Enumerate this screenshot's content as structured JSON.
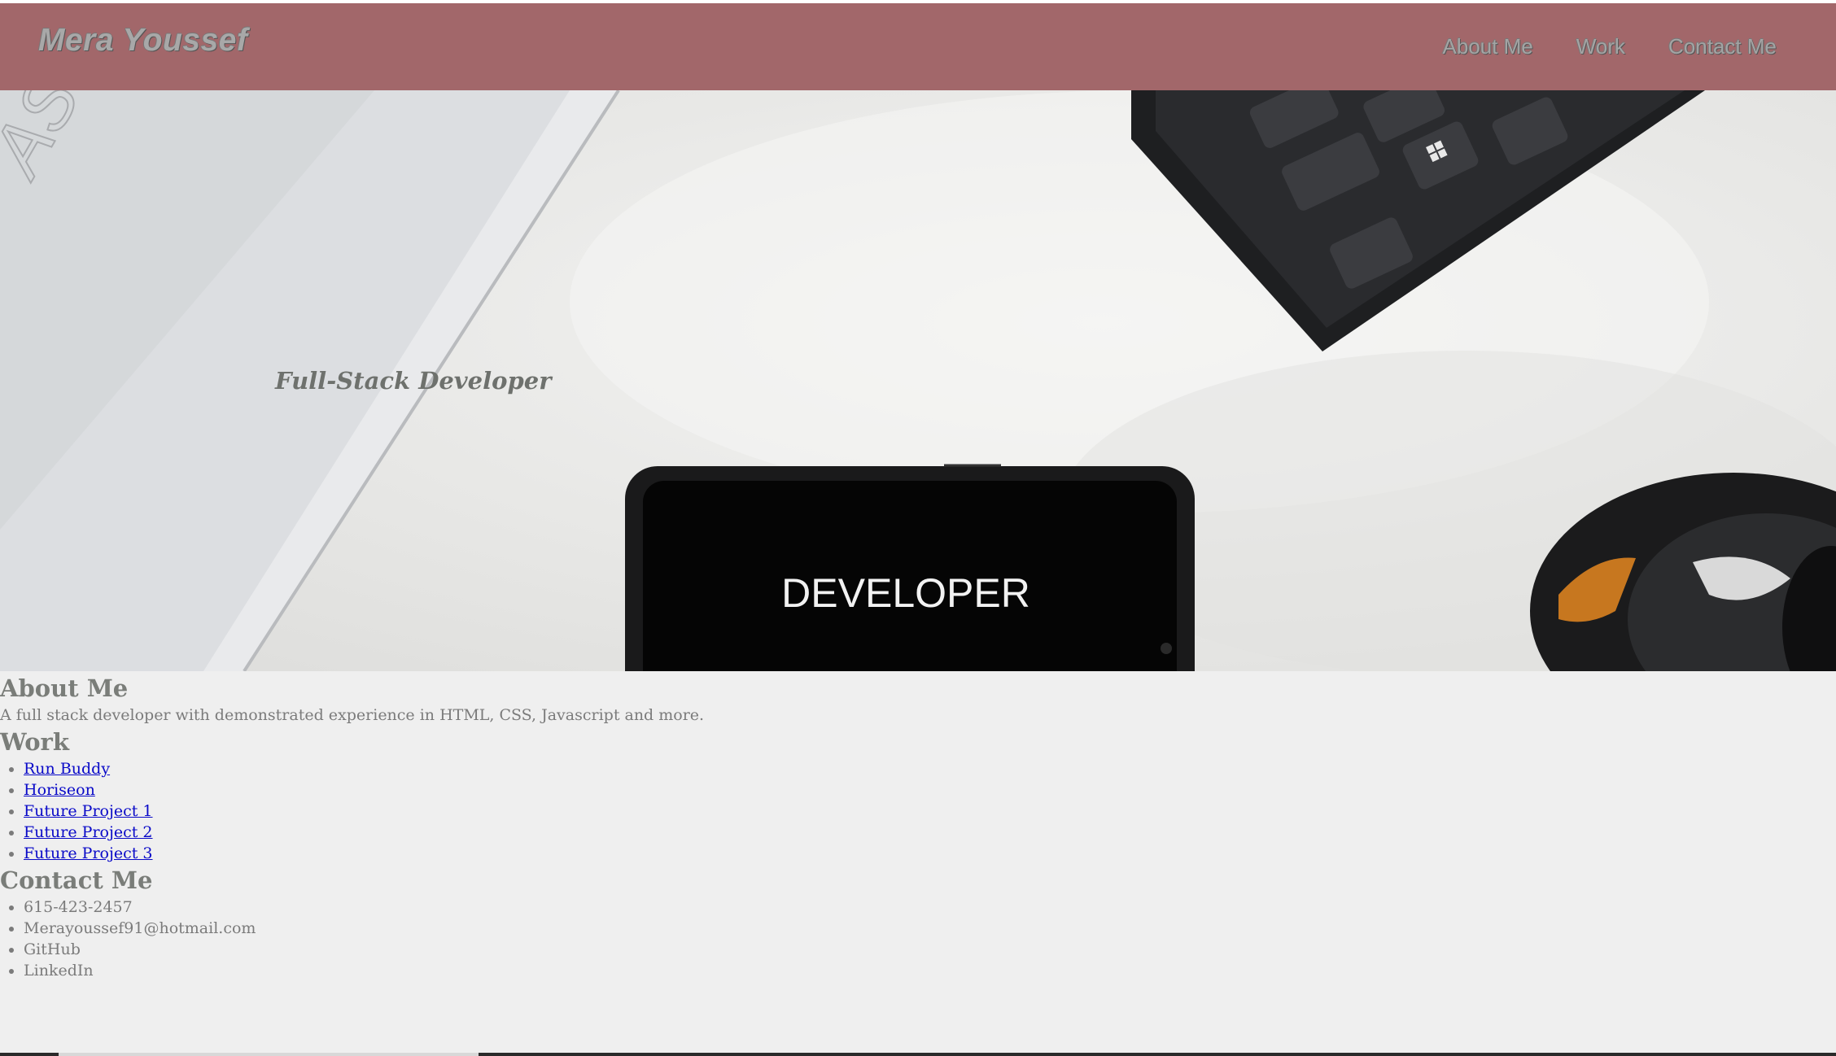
{
  "header": {
    "brand": "Mera Youssef",
    "nav": [
      {
        "label": "About Me"
      },
      {
        "label": "Work"
      },
      {
        "label": "Contact Me"
      }
    ]
  },
  "hero": {
    "tagline": "Full-Stack Developer",
    "phone_screen_text": "DEVELOPER",
    "laptop_logo_text": "ASUS"
  },
  "about": {
    "title": "About Me",
    "text": "A full stack developer with demonstrated experience in HTML, CSS, Javascript and more."
  },
  "work": {
    "title": "Work",
    "items": [
      {
        "label": "Run Buddy"
      },
      {
        "label": "Horiseon"
      },
      {
        "label": "Future Project 1"
      },
      {
        "label": "Future Project 2"
      },
      {
        "label": "Future Project 3"
      }
    ]
  },
  "contact": {
    "title": "Contact Me",
    "items": [
      {
        "label": "615-423-2457"
      },
      {
        "label": "Merayoussef91@hotmail.com"
      },
      {
        "label": "GitHub"
      },
      {
        "label": "LinkedIn"
      }
    ]
  },
  "colors": {
    "navbar": "#a2676a",
    "page_bg": "#efefef",
    "link": "#0a0ac8",
    "text": "#7b7b7b"
  }
}
